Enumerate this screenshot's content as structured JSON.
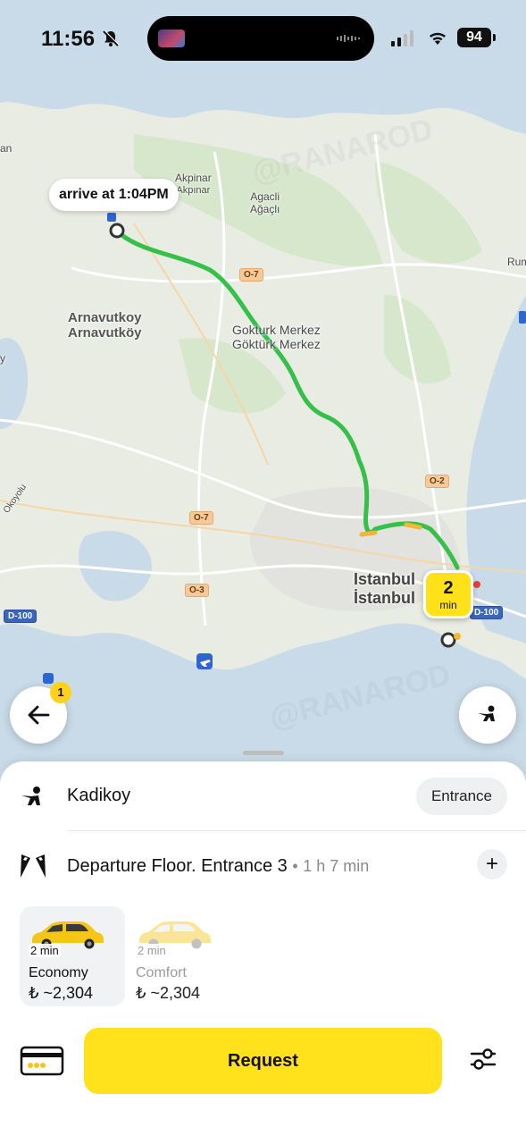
{
  "status_bar": {
    "time": "11:56",
    "battery": "94",
    "icons": [
      "bell-slash-icon",
      "signal-icon",
      "wifi-icon",
      "battery-icon"
    ]
  },
  "map": {
    "labels": {
      "an": "an",
      "akpinar_1": "Akpinar",
      "akpinar_2": "Akpınar",
      "agacli_1": "Agacli",
      "agacli_2": "Ağaçlı",
      "arnavutkoy_1": "Arnavutkoy",
      "arnavutkoy_2": "Arnavutköy",
      "gokturk_1": "Gokturk Merkez",
      "gokturk_2": "Göktürk Merkez",
      "rum": "Rum",
      "istanbul_1": "Istanbul",
      "istanbul_2": "İstanbul",
      "okoyolu": "Okoyolu",
      "y": "y"
    },
    "roads": {
      "o7_a": "O-7",
      "o7_b": "O-7",
      "o2": "O-2",
      "o3": "O-3",
      "d100_left": "D-100",
      "d100_right": "D-100"
    },
    "route_color": "#35c04a",
    "arrive_label": "arrive at 1:04PM",
    "eta": {
      "value": "2",
      "unit": "min"
    },
    "back_badge_count": "1",
    "watermark": "@RANAROD"
  },
  "sheet": {
    "pickup": {
      "label": "Kadikoy",
      "entrance_button": "Entrance"
    },
    "destination": {
      "label": "Departure Floor. Entrance 3",
      "separator": "•",
      "duration": "1 h 7 min"
    },
    "tariffs": [
      {
        "eta": "2 min",
        "name": "Economy",
        "price": "₺ ~2,304",
        "selected": true
      },
      {
        "eta": "2 min",
        "name": "Comfort",
        "price": "₺ ~2,304",
        "selected": false
      }
    ],
    "request_button": "Request",
    "accent": "#ffe21c"
  }
}
